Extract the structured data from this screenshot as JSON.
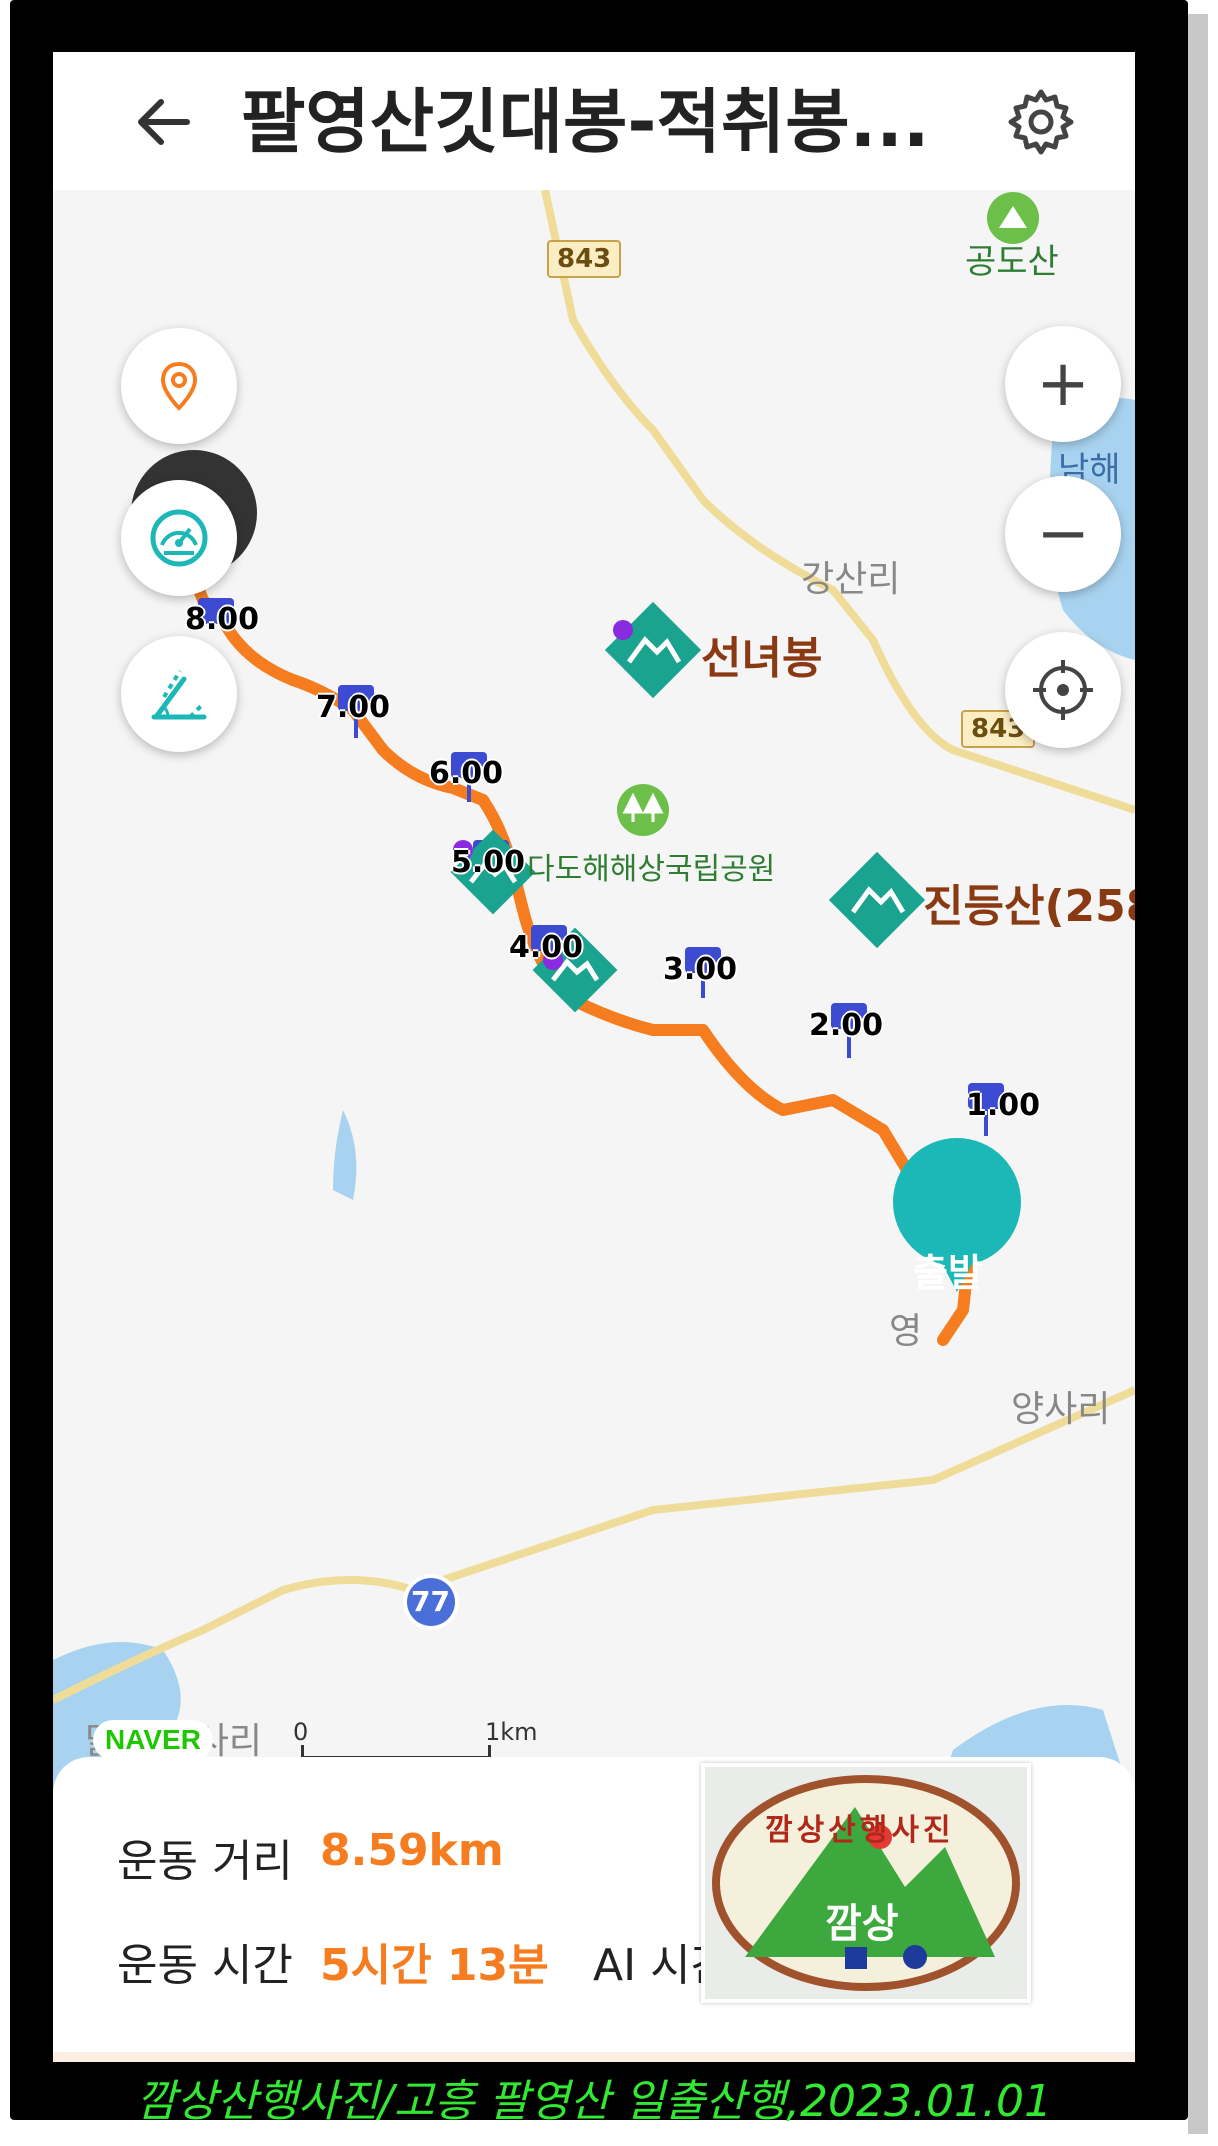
{
  "header": {
    "title": "팔영산깃대봉-적취봉..."
  },
  "map": {
    "route_shields": [
      "843",
      "843"
    ],
    "highway_shield": "77",
    "places": {
      "gangsanri": "강산리",
      "yangsari": "양사리",
      "namhae": "남해",
      "yeong": "영",
      "bottom_left": "닭섬 남사리",
      "top_peak": "공도산"
    },
    "pois": {
      "seonnyeobong": "선녀봉",
      "jindeungsan": "진등산(258",
      "park": "다도해해상국립공원"
    },
    "km_markers": [
      "8.00",
      "7.00",
      "6.00",
      "5.00",
      "4.00",
      "3.00",
      "2.00",
      "1.00"
    ],
    "start_marker": "출발",
    "naver_logo": "NAVER",
    "scale_start": "0",
    "scale_end": "1km",
    "route_color": "#f57c1f",
    "poi_color": "#1aa38f",
    "marker_color": "#3c4bd1"
  },
  "controls": {
    "zoom_in": "+",
    "zoom_out": "−"
  },
  "stats": {
    "distance_label": "운동 거리",
    "distance_value": "8.59km",
    "time_label": "운동 시간",
    "time_value": "5시간 13분",
    "ai_label": "AI 시간"
  },
  "watermark_logo": {
    "top_text": "깜상산행사진",
    "center_text": "깜상"
  },
  "caption": "깜상산행사진/고흥 팔영산 일출산행,2023.01.01"
}
